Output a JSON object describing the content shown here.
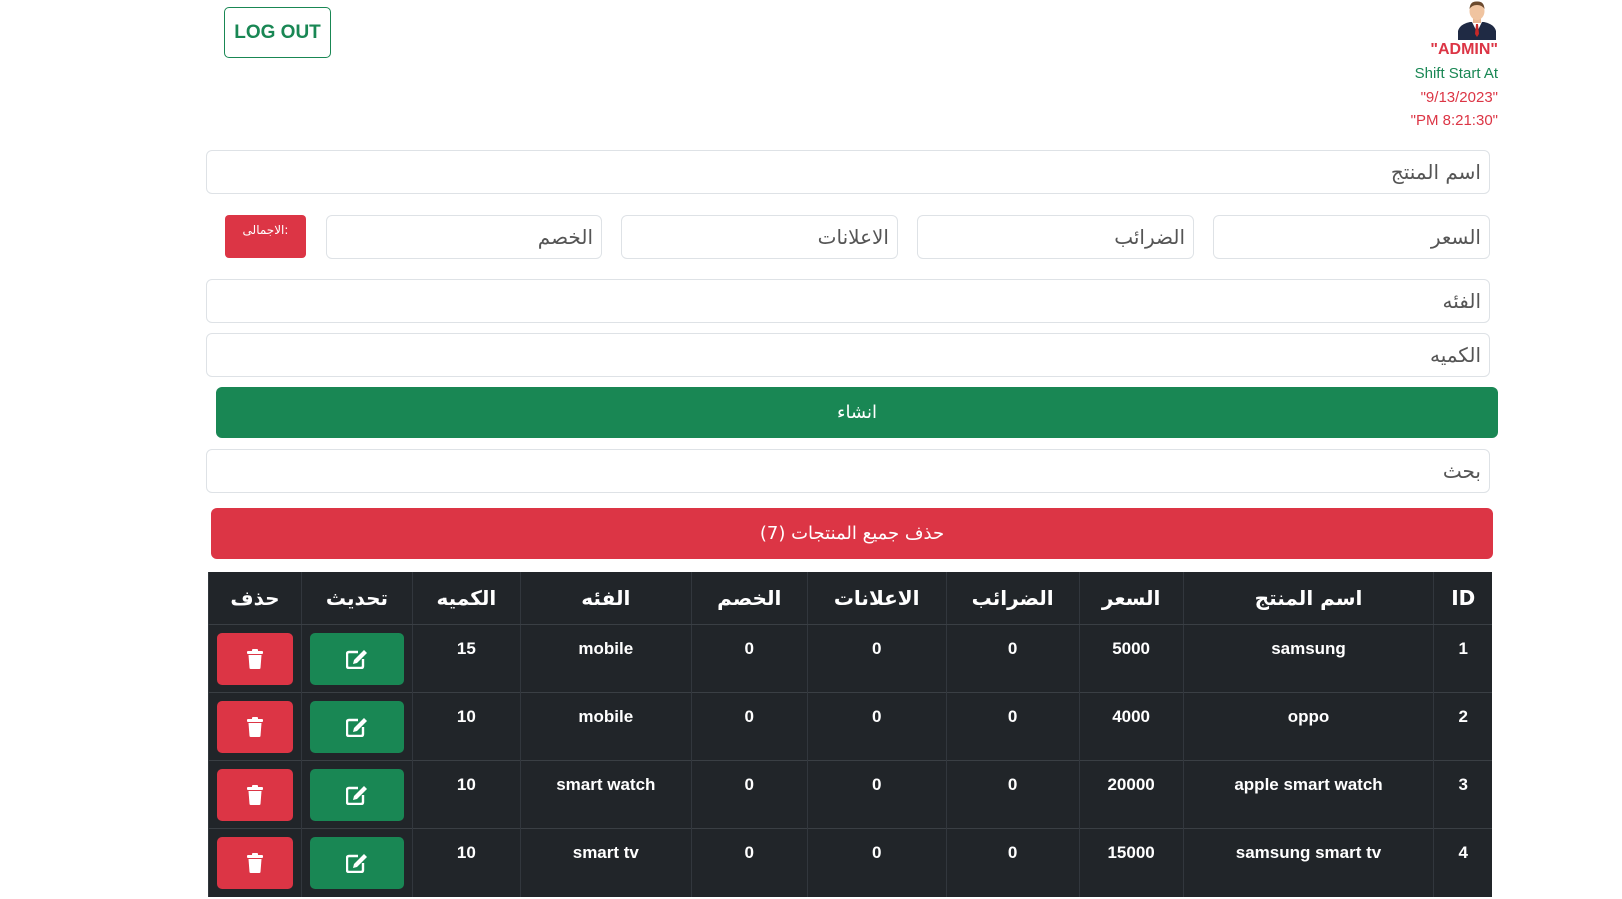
{
  "header": {
    "logout_label": "LOG OUT",
    "role": "\"ADMIN\"",
    "shift_label": "Shift Start At",
    "shift_date": "\"9/13/2023\"",
    "shift_time": "\"PM 8:21:30\""
  },
  "form": {
    "product_name_placeholder": "اسم المنتج",
    "price_placeholder": "السعر",
    "taxes_placeholder": "الضرائب",
    "ads_placeholder": "الاعلانات",
    "discount_placeholder": "الخصم",
    "total_label": "الاجمالى:",
    "category_placeholder": "الفئه",
    "quantity_placeholder": "الكميه",
    "create_label": "انشاء",
    "search_placeholder": "بحث",
    "delete_all_label": "حذف جميع المنتجات (7)"
  },
  "table": {
    "headers": [
      "ID",
      "اسم المنتج",
      "السعر",
      "الضرائب",
      "الاعلانات",
      "الخصم",
      "الفئه",
      "الكميه",
      "تحديث",
      "حذف"
    ],
    "rows": [
      {
        "id": "1",
        "name": "samsung",
        "price": "5000",
        "taxes": "0",
        "ads": "0",
        "discount": "0",
        "category": "mobile",
        "quantity": "15"
      },
      {
        "id": "2",
        "name": "oppo",
        "price": "4000",
        "taxes": "0",
        "ads": "0",
        "discount": "0",
        "category": "mobile",
        "quantity": "10"
      },
      {
        "id": "3",
        "name": "apple smart watch",
        "price": "20000",
        "taxes": "0",
        "ads": "0",
        "discount": "0",
        "category": "smart watch",
        "quantity": "10"
      },
      {
        "id": "4",
        "name": "samsung smart tv",
        "price": "15000",
        "taxes": "0",
        "ads": "0",
        "discount": "0",
        "category": "smart tv",
        "quantity": "10"
      }
    ]
  },
  "icons": {
    "update": "edit-icon",
    "delete": "trash-icon",
    "avatar": "businessman-avatar"
  },
  "colors": {
    "primary_green": "#198754",
    "danger_red": "#dc3545",
    "table_dark": "#212529"
  }
}
